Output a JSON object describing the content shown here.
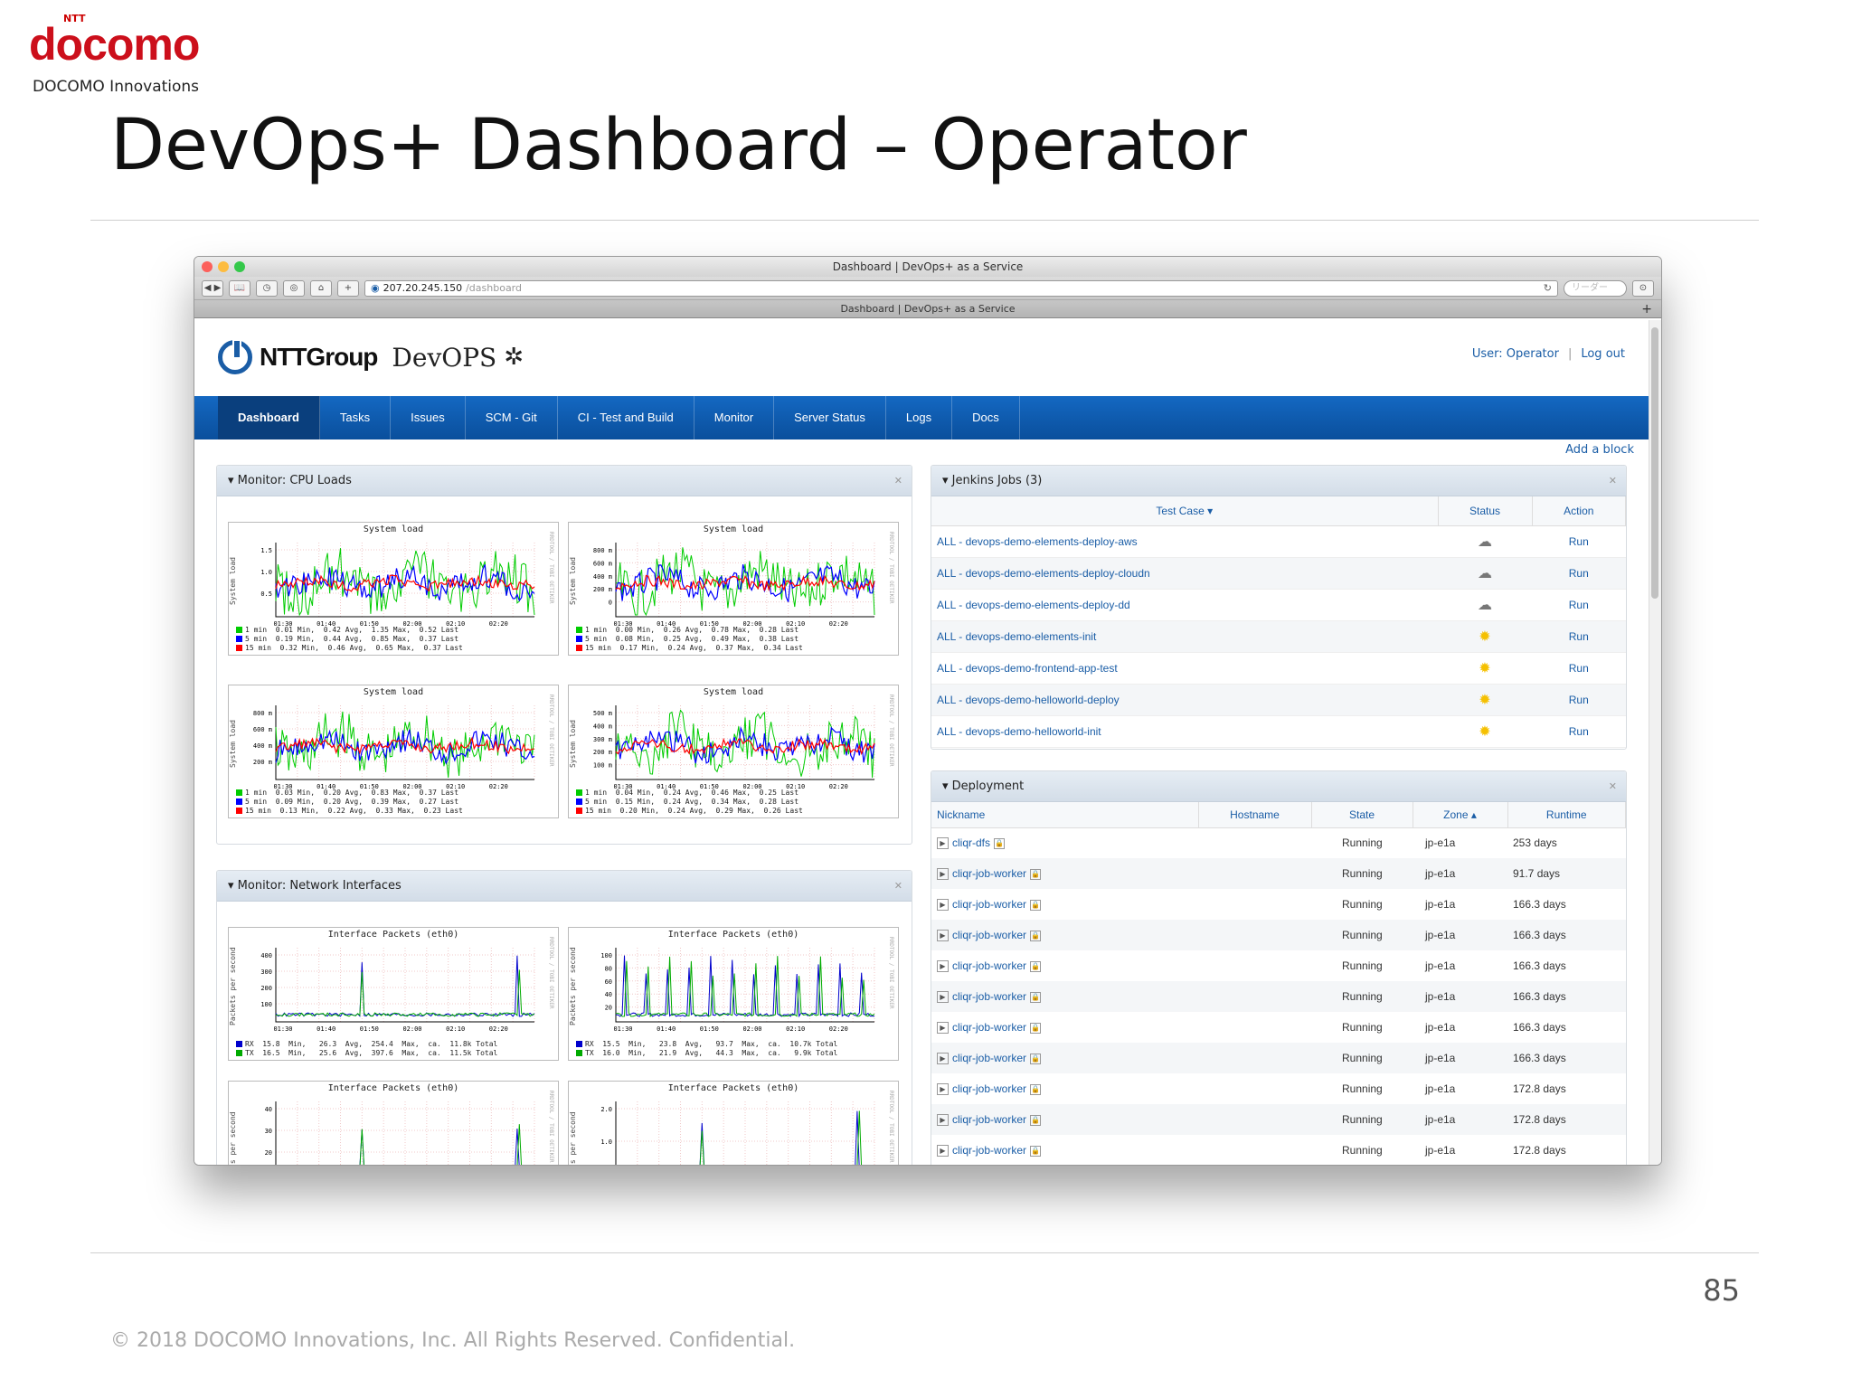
{
  "slide": {
    "logo_small": "NTT",
    "logo": "docomo",
    "subtitle": "DOCOMO Innovations",
    "title": "DevOps+ Dashboard – Operator",
    "page_number": "85",
    "copyright": "© 2018 DOCOMO Innovations, Inc. All Rights Reserved. Confidential.",
    "brand_color": "#cc0f1b"
  },
  "browser": {
    "window_title": "Dashboard | DevOps+ as a Service",
    "url_host": "207.20.245.150",
    "url_path": "/dashboard",
    "search_placeholder": "リーダー",
    "tab_title": "Dashboard | DevOps+ as a Service"
  },
  "app": {
    "brand_group": "NTTGroup",
    "brand_product": "DevOPS",
    "user_label": "User: Operator",
    "logout_label": "Log out",
    "add_block": "Add a block",
    "nav": [
      "Dashboard",
      "Tasks",
      "Issues",
      "SCM - Git",
      "CI - Test and Build",
      "Monitor",
      "Server Status",
      "Logs",
      "Docs"
    ],
    "accent": "#1468c2"
  },
  "cpu_panel": {
    "title": "▾ Monitor: CPU Loads",
    "charts": [
      {
        "title": "System load",
        "ylabel": "System load",
        "ticks_y": [
          "1.5",
          "1.0",
          "0.5"
        ],
        "ticks_x": [
          "01:30",
          "01:40",
          "01:50",
          "02:00",
          "02:10",
          "02:20"
        ],
        "legend": [
          "1 min  0.01 Min,  0.42 Avg,  1.35 Max,  0.52 Last",
          "5 min  0.19 Min,  0.44 Avg,  0.85 Max,  0.37 Last",
          "15 min  0.32 Min,  0.46 Avg,  0.65 Max,  0.37 Last"
        ]
      },
      {
        "title": "System load",
        "ylabel": "System load",
        "ticks_y": [
          "800 m",
          "600 m",
          "400 m",
          "200 m",
          "0"
        ],
        "ticks_x": [
          "01:30",
          "01:40",
          "01:50",
          "02:00",
          "02:10",
          "02:20"
        ],
        "legend": [
          "1 min  0.00 Min,  0.26 Avg,  0.78 Max,  0.28 Last",
          "5 min  0.08 Min,  0.25 Avg,  0.49 Max,  0.38 Last",
          "15 min  0.17 Min,  0.24 Avg,  0.37 Max,  0.34 Last"
        ]
      },
      {
        "title": "System load",
        "ylabel": "System load",
        "ticks_y": [
          "800 m",
          "600 m",
          "400 m",
          "200 m"
        ],
        "ticks_x": [
          "01:30",
          "01:40",
          "01:50",
          "02:00",
          "02:10",
          "02:20"
        ],
        "legend": [
          "1 min  0.03 Min,  0.20 Avg,  0.83 Max,  0.37 Last",
          "5 min  0.09 Min,  0.20 Avg,  0.39 Max,  0.27 Last",
          "15 min  0.13 Min,  0.22 Avg,  0.33 Max,  0.23 Last"
        ]
      },
      {
        "title": "System load",
        "ylabel": "System load",
        "ticks_y": [
          "500 m",
          "400 m",
          "300 m",
          "200 m",
          "100 m"
        ],
        "ticks_x": [
          "01:30",
          "01:40",
          "01:50",
          "02:00",
          "02:10",
          "02:20"
        ],
        "legend": [
          "1 min  0.04 Min,  0.24 Avg,  0.46 Max,  0.25 Last",
          "5 min  0.15 Min,  0.24 Avg,  0.34 Max,  0.28 Last",
          "15 min  0.20 Min,  0.24 Avg,  0.29 Max,  0.26 Last"
        ]
      }
    ]
  },
  "net_panel": {
    "title": "▾ Monitor: Network Interfaces",
    "charts": [
      {
        "title": "Interface Packets (eth0)",
        "ylabel": "Packets per second",
        "ticks_y": [
          "400",
          "300",
          "200",
          "100"
        ],
        "ticks_x": [
          "01:30",
          "01:40",
          "01:50",
          "02:00",
          "02:10",
          "02:20"
        ],
        "legend": [
          "RX  15.8  Min,   26.3  Avg,  254.4  Max,  ca.  11.8k Total",
          "TX  16.5  Min,   25.6  Avg,  397.6  Max,  ca.  11.5k Total"
        ]
      },
      {
        "title": "Interface Packets (eth0)",
        "ylabel": "Packets per second",
        "ticks_y": [
          "100",
          "80",
          "60",
          "40",
          "20"
        ],
        "ticks_x": [
          "01:30",
          "01:40",
          "01:50",
          "02:00",
          "02:10",
          "02:20"
        ],
        "legend": [
          "RX  15.5  Min,   23.8  Avg,   93.7  Max,  ca.  10.7k Total",
          "TX  16.0  Min,   21.9  Avg,   44.3  Max,  ca.   9.9k Total"
        ]
      },
      {
        "title": "Interface Packets (eth0)",
        "ylabel": "ts per second",
        "ticks_y": [
          "40",
          "30",
          "20"
        ],
        "ticks_x": [],
        "legend": []
      },
      {
        "title": "Interface Packets (eth0)",
        "ylabel": "ts per second",
        "ticks_y": [
          "2.0",
          "1.0"
        ],
        "ticks_x": [],
        "legend": []
      }
    ]
  },
  "jenkins": {
    "title": "▾ Jenkins Jobs (3)",
    "headers": [
      "Test Case ▾",
      "Status",
      "Action"
    ],
    "jobs": [
      {
        "name": "ALL - devops-demo-elements-deploy-aws",
        "status": "cloudy",
        "action": "Run"
      },
      {
        "name": "ALL - devops-demo-elements-deploy-cloudn",
        "status": "cloudy",
        "action": "Run"
      },
      {
        "name": "ALL - devops-demo-elements-deploy-dd",
        "status": "cloudy",
        "action": "Run"
      },
      {
        "name": "ALL - devops-demo-elements-init",
        "status": "sunny",
        "action": "Run"
      },
      {
        "name": "ALL - devops-demo-frontend-app-test",
        "status": "sunny",
        "action": "Run"
      },
      {
        "name": "ALL - devops-demo-helloworld-deploy",
        "status": "sunny",
        "action": "Run"
      },
      {
        "name": "ALL - devops-demo-helloworld-init",
        "status": "sunny",
        "action": "Run"
      }
    ]
  },
  "deployment": {
    "title": "▾ Deployment",
    "headers": [
      "Nickname",
      "Hostname",
      "State",
      "Zone ▴",
      "Runtime"
    ],
    "rows": [
      {
        "nickname": "cliqr-dfs",
        "state": "Running",
        "zone": "jp-e1a",
        "runtime": "253 days"
      },
      {
        "nickname": "cliqr-job-worker",
        "state": "Running",
        "zone": "jp-e1a",
        "runtime": "91.7 days"
      },
      {
        "nickname": "cliqr-job-worker",
        "state": "Running",
        "zone": "jp-e1a",
        "runtime": "166.3 days"
      },
      {
        "nickname": "cliqr-job-worker",
        "state": "Running",
        "zone": "jp-e1a",
        "runtime": "166.3 days"
      },
      {
        "nickname": "cliqr-job-worker",
        "state": "Running",
        "zone": "jp-e1a",
        "runtime": "166.3 days"
      },
      {
        "nickname": "cliqr-job-worker",
        "state": "Running",
        "zone": "jp-e1a",
        "runtime": "166.3 days"
      },
      {
        "nickname": "cliqr-job-worker",
        "state": "Running",
        "zone": "jp-e1a",
        "runtime": "166.3 days"
      },
      {
        "nickname": "cliqr-job-worker",
        "state": "Running",
        "zone": "jp-e1a",
        "runtime": "166.3 days"
      },
      {
        "nickname": "cliqr-job-worker",
        "state": "Running",
        "zone": "jp-e1a",
        "runtime": "172.8 days"
      },
      {
        "nickname": "cliqr-job-worker",
        "state": "Running",
        "zone": "jp-e1a",
        "runtime": "172.8 days"
      },
      {
        "nickname": "cliqr-job-worker",
        "state": "Running",
        "zone": "jp-e1a",
        "runtime": "172.8 days"
      }
    ]
  }
}
